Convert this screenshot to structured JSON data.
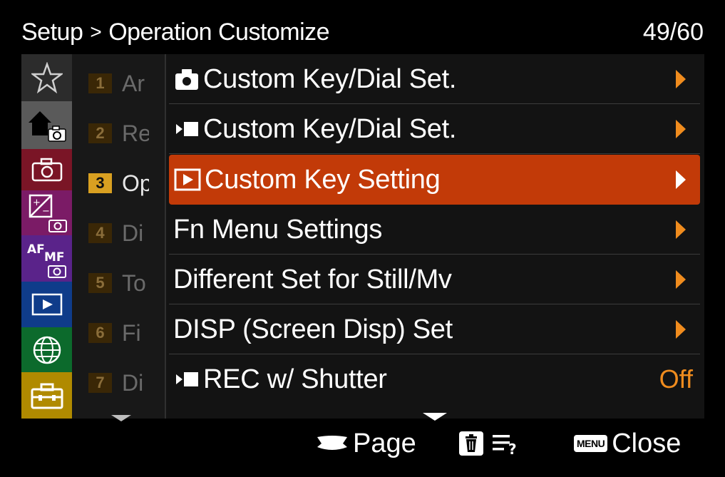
{
  "header": {
    "section": "Setup",
    "separator": ">",
    "subsection": "Operation Customize",
    "page_counter": "49/60"
  },
  "tabs": [
    {
      "icon": "star-icon",
      "color": "#2c2c2c",
      "active": false
    },
    {
      "icon": "home-camera-icon",
      "color": "#5a5a5a",
      "active": true
    },
    {
      "icon": "camera-icon",
      "color": "#7a1526"
    },
    {
      "icon": "exposure-camera-icon",
      "color": "#7b1b66"
    },
    {
      "icon": "af-mf-camera-icon",
      "color": "#5a238a"
    },
    {
      "icon": "playback-icon",
      "color": "#0f3c8a"
    },
    {
      "icon": "globe-icon",
      "color": "#0c6a2c"
    },
    {
      "icon": "toolbox-icon",
      "color": "#b08a00"
    }
  ],
  "sublist": [
    {
      "num": "1",
      "text": "Ar",
      "active": false
    },
    {
      "num": "2",
      "text": "Re",
      "active": false
    },
    {
      "num": "3",
      "text": "Op",
      "active": true
    },
    {
      "num": "4",
      "text": "Di",
      "active": false
    },
    {
      "num": "5",
      "text": "To",
      "active": false
    },
    {
      "num": "6",
      "text": "Fi",
      "active": false
    },
    {
      "num": "7",
      "text": "Di",
      "active": false
    }
  ],
  "menu": {
    "items": [
      {
        "label": "Custom Key/Dial Set.",
        "icon": "still-camera-icon",
        "value": null,
        "selected": false
      },
      {
        "label": "Custom Key/Dial Set.",
        "icon": "movie-icon",
        "value": null,
        "selected": false
      },
      {
        "label": "Custom Key Setting",
        "icon": "playback-icon",
        "value": null,
        "selected": true
      },
      {
        "label": "Fn Menu Settings",
        "icon": null,
        "value": null,
        "selected": false
      },
      {
        "label": "Different Set for Still/Mv",
        "icon": null,
        "value": null,
        "selected": false
      },
      {
        "label": "DISP (Screen Disp) Set",
        "icon": null,
        "value": null,
        "selected": false
      },
      {
        "label": "REC w/ Shutter",
        "icon": "movie-icon",
        "value": "Off",
        "selected": false
      }
    ]
  },
  "footer": {
    "page_label": "Page",
    "menu_badge": "MENU",
    "close_label": "Close"
  },
  "colors": {
    "selection": "#c23a08",
    "accent_orange": "#f08c1e",
    "sub_active": "#d9a021"
  }
}
